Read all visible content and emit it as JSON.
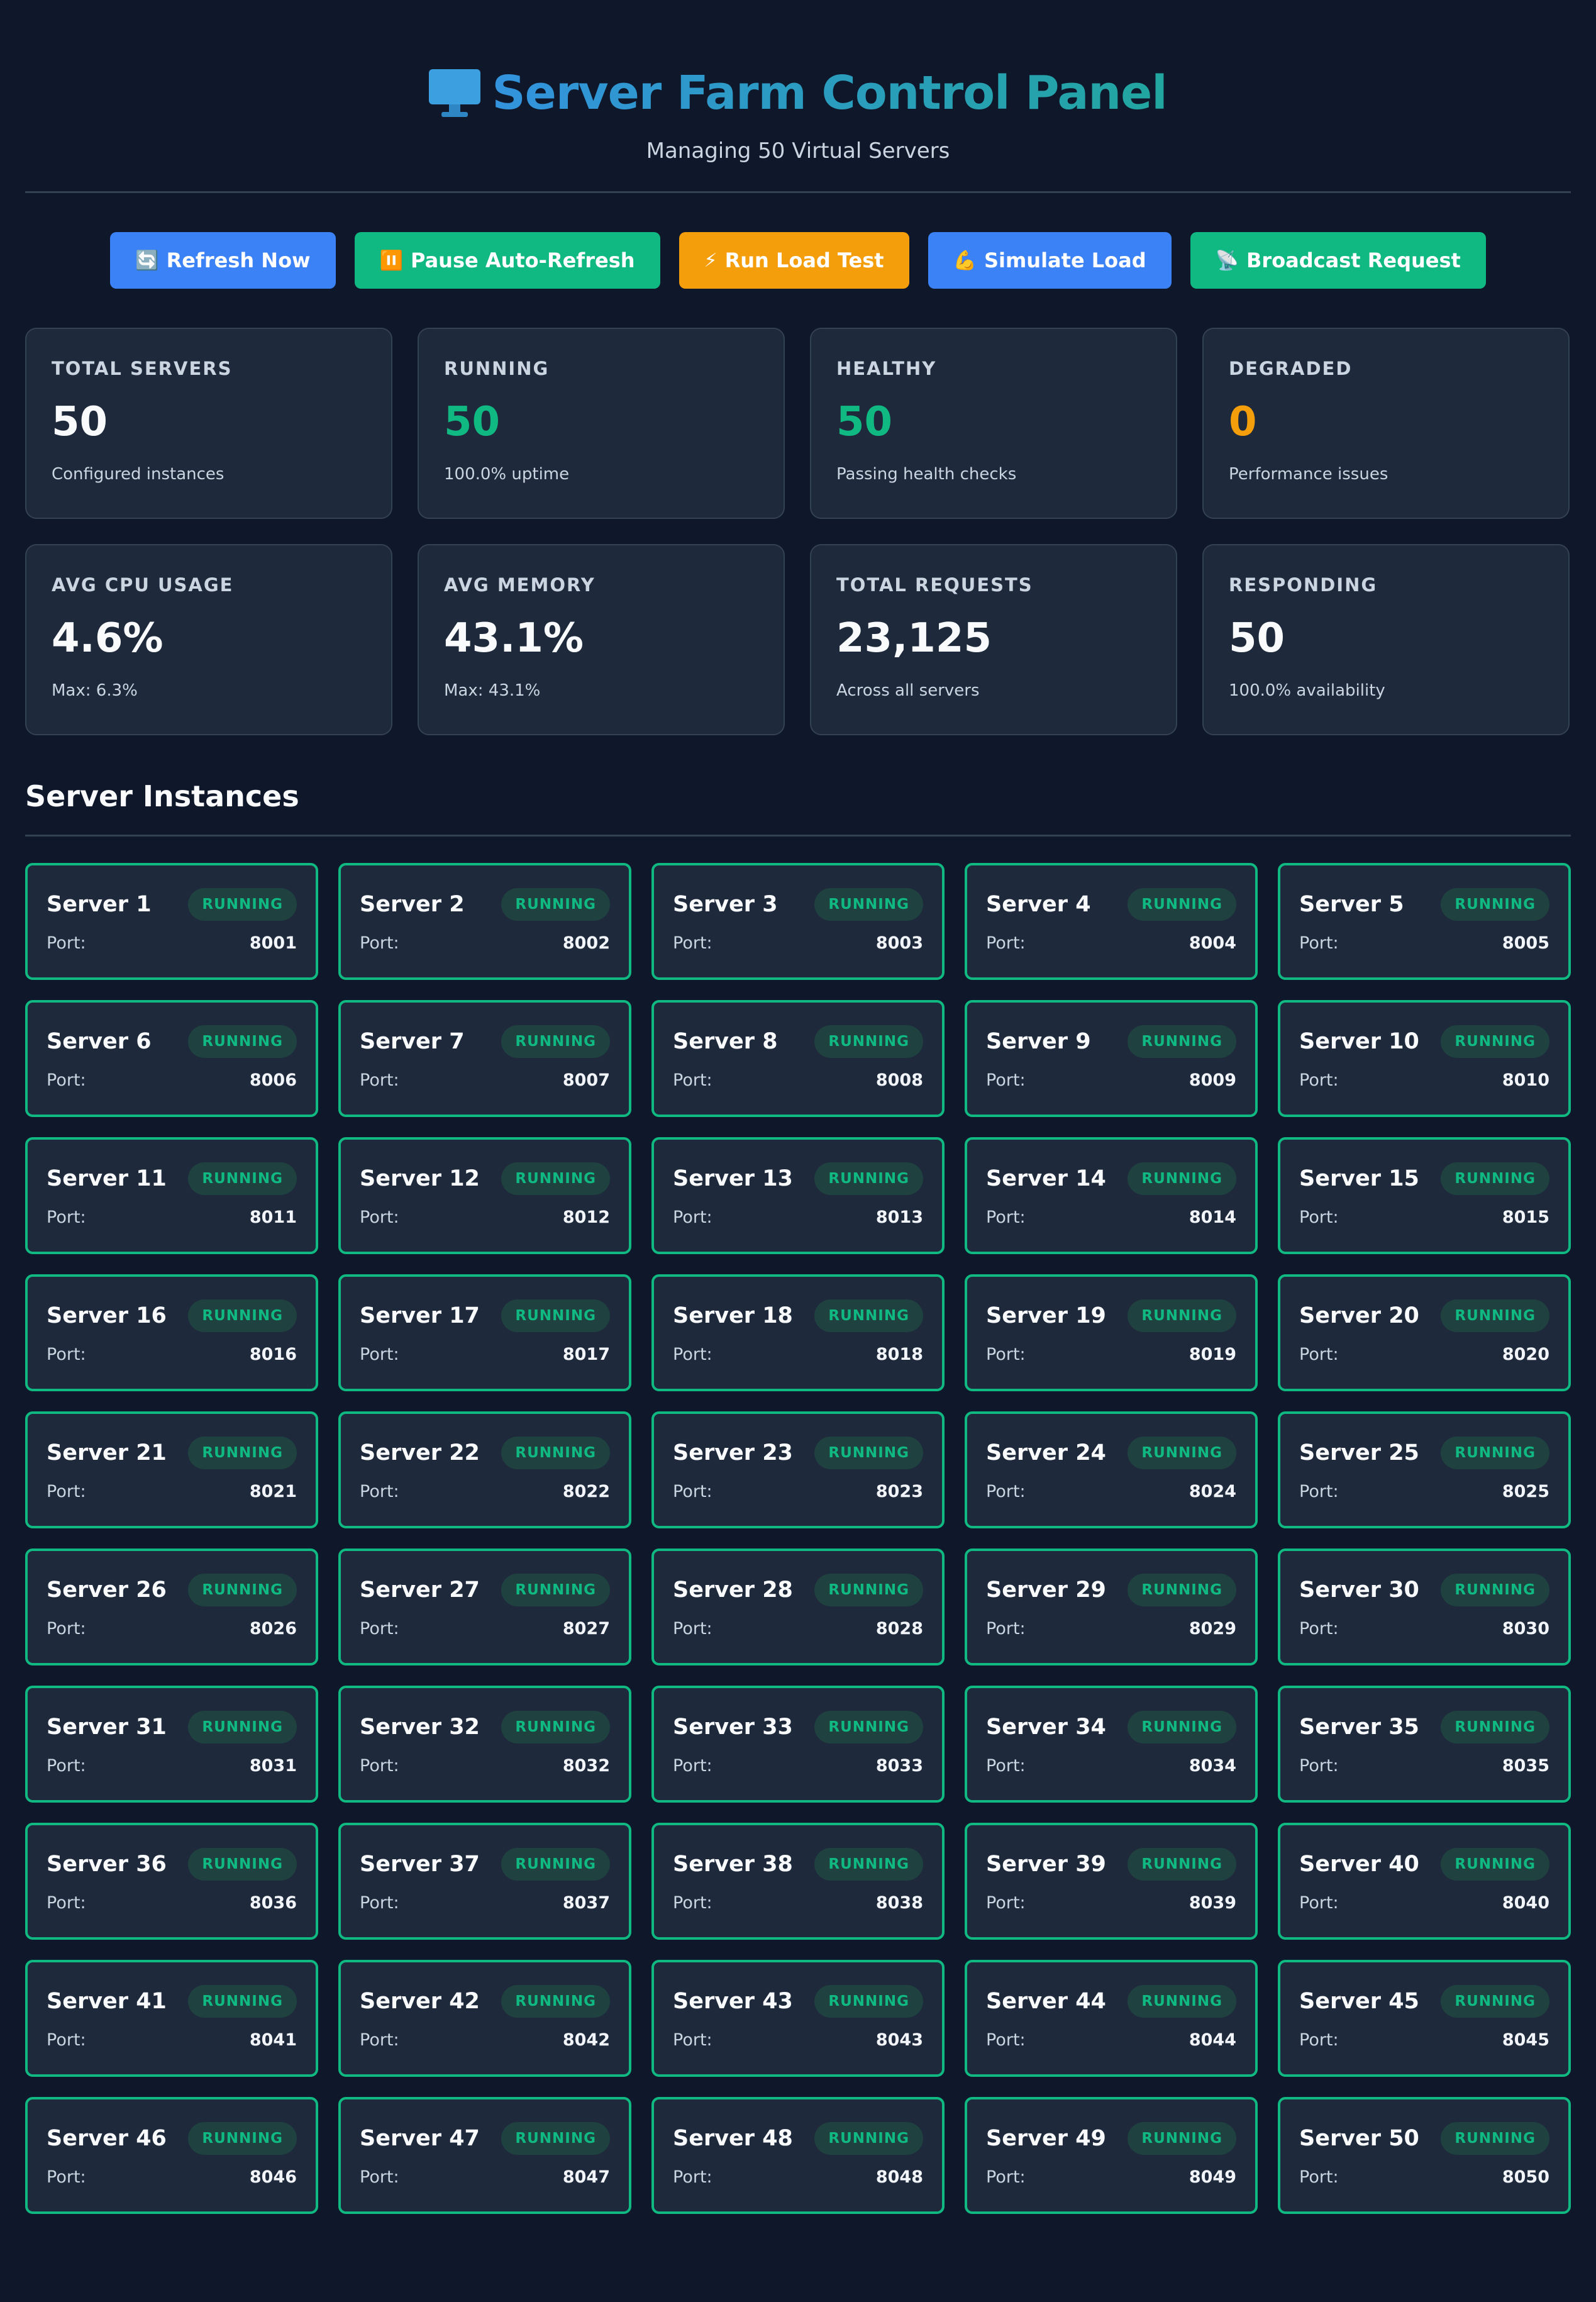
{
  "header": {
    "title": "Server Farm Control Panel",
    "icon": "monitor-icon",
    "subtitle": "Managing 50 Virtual Servers",
    "title_gradient": [
      "#3393dd",
      "#22a6a0"
    ]
  },
  "toolbar": {
    "buttons": [
      {
        "icon": "🔄",
        "label": "Refresh Now",
        "color": "#3b82f6"
      },
      {
        "icon": "⏸️",
        "label": "Pause Auto-Refresh",
        "color": "#10b981"
      },
      {
        "icon": "⚡",
        "label": "Run Load Test",
        "color": "#f59e0b"
      },
      {
        "icon": "💪",
        "label": "Simulate Load",
        "color": "#3b82f6"
      },
      {
        "icon": "📡",
        "label": "Broadcast Request",
        "color": "#10b981"
      }
    ]
  },
  "stats": [
    {
      "label": "TOTAL SERVERS",
      "value": "50",
      "sub": "Configured instances",
      "color": "#f8fafc"
    },
    {
      "label": "RUNNING",
      "value": "50",
      "sub": "100.0% uptime",
      "color": "#10b981"
    },
    {
      "label": "HEALTHY",
      "value": "50",
      "sub": "Passing health checks",
      "color": "#10b981"
    },
    {
      "label": "DEGRADED",
      "value": "0",
      "sub": "Performance issues",
      "color": "#f59e0b"
    },
    {
      "label": "AVG CPU USAGE",
      "value": "4.6%",
      "sub": "Max: 6.3%",
      "color": "#f8fafc"
    },
    {
      "label": "AVG MEMORY",
      "value": "43.1%",
      "sub": "Max: 43.1%",
      "color": "#f8fafc"
    },
    {
      "label": "TOTAL REQUESTS",
      "value": "23,125",
      "sub": "Across all servers",
      "color": "#f8fafc"
    },
    {
      "label": "RESPONDING",
      "value": "50",
      "sub": "100.0% availability",
      "color": "#f8fafc"
    }
  ],
  "section": {
    "title": "Server Instances"
  },
  "servers": {
    "status": "RUNNING",
    "port_label": "Port:",
    "status_color": "#10b981",
    "items": [
      {
        "name": "Server 1",
        "port": "8001"
      },
      {
        "name": "Server 2",
        "port": "8002"
      },
      {
        "name": "Server 3",
        "port": "8003"
      },
      {
        "name": "Server 4",
        "port": "8004"
      },
      {
        "name": "Server 5",
        "port": "8005"
      },
      {
        "name": "Server 6",
        "port": "8006"
      },
      {
        "name": "Server 7",
        "port": "8007"
      },
      {
        "name": "Server 8",
        "port": "8008"
      },
      {
        "name": "Server 9",
        "port": "8009"
      },
      {
        "name": "Server 10",
        "port": "8010"
      },
      {
        "name": "Server 11",
        "port": "8011"
      },
      {
        "name": "Server 12",
        "port": "8012"
      },
      {
        "name": "Server 13",
        "port": "8013"
      },
      {
        "name": "Server 14",
        "port": "8014"
      },
      {
        "name": "Server 15",
        "port": "8015"
      },
      {
        "name": "Server 16",
        "port": "8016"
      },
      {
        "name": "Server 17",
        "port": "8017"
      },
      {
        "name": "Server 18",
        "port": "8018"
      },
      {
        "name": "Server 19",
        "port": "8019"
      },
      {
        "name": "Server 20",
        "port": "8020"
      },
      {
        "name": "Server 21",
        "port": "8021"
      },
      {
        "name": "Server 22",
        "port": "8022"
      },
      {
        "name": "Server 23",
        "port": "8023"
      },
      {
        "name": "Server 24",
        "port": "8024"
      },
      {
        "name": "Server 25",
        "port": "8025"
      },
      {
        "name": "Server 26",
        "port": "8026"
      },
      {
        "name": "Server 27",
        "port": "8027"
      },
      {
        "name": "Server 28",
        "port": "8028"
      },
      {
        "name": "Server 29",
        "port": "8029"
      },
      {
        "name": "Server 30",
        "port": "8030"
      },
      {
        "name": "Server 31",
        "port": "8031"
      },
      {
        "name": "Server 32",
        "port": "8032"
      },
      {
        "name": "Server 33",
        "port": "8033"
      },
      {
        "name": "Server 34",
        "port": "8034"
      },
      {
        "name": "Server 35",
        "port": "8035"
      },
      {
        "name": "Server 36",
        "port": "8036"
      },
      {
        "name": "Server 37",
        "port": "8037"
      },
      {
        "name": "Server 38",
        "port": "8038"
      },
      {
        "name": "Server 39",
        "port": "8039"
      },
      {
        "name": "Server 40",
        "port": "8040"
      },
      {
        "name": "Server 41",
        "port": "8041"
      },
      {
        "name": "Server 42",
        "port": "8042"
      },
      {
        "name": "Server 43",
        "port": "8043"
      },
      {
        "name": "Server 44",
        "port": "8044"
      },
      {
        "name": "Server 45",
        "port": "8045"
      },
      {
        "name": "Server 46",
        "port": "8046"
      },
      {
        "name": "Server 47",
        "port": "8047"
      },
      {
        "name": "Server 48",
        "port": "8048"
      },
      {
        "name": "Server 49",
        "port": "8049"
      },
      {
        "name": "Server 50",
        "port": "8050"
      }
    ]
  }
}
